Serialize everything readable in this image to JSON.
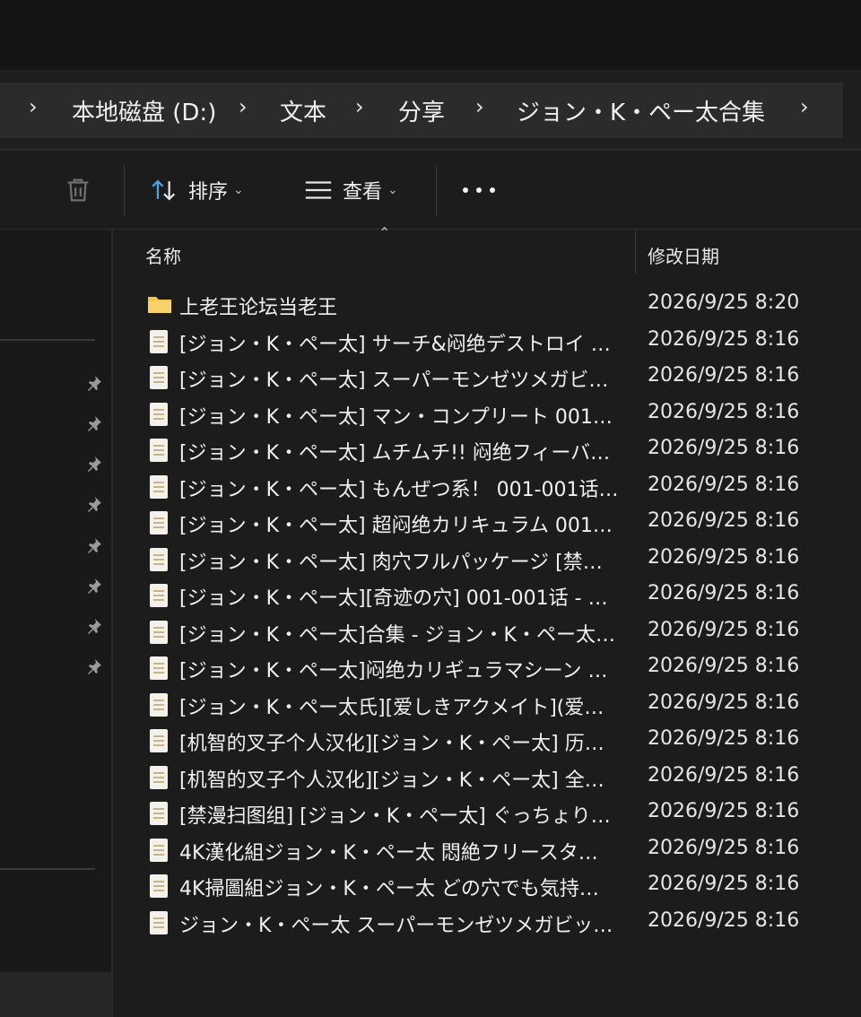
{
  "breadcrumb": {
    "items": [
      "本地磁盘 (D:)",
      "文本",
      "分享",
      "ジョン・K・ペー太合集"
    ]
  },
  "toolbar": {
    "sort_label": "排序",
    "view_label": "查看",
    "delete_icon": "trash-icon",
    "more_icon": "more-icon"
  },
  "columns": {
    "name": "名称",
    "date": "修改日期"
  },
  "files": [
    {
      "name": "上老王论坛当老王",
      "date": "2026/9/25 8:20",
      "type": "folder"
    },
    {
      "name": "[ジョン・K・ペー太] サーチ&闷绝デストロイ …",
      "date": "2026/9/25 8:16",
      "type": "file"
    },
    {
      "name": "[ジョン・K・ペー太] スーパーモンゼツメガビ…",
      "date": "2026/9/25 8:16",
      "type": "file"
    },
    {
      "name": "[ジョン・K・ペー太] マン・コンプリート 001…",
      "date": "2026/9/25 8:16",
      "type": "file"
    },
    {
      "name": "[ジョン・K・ペー太] ムチムチ!! 闷绝フィーバ…",
      "date": "2026/9/25 8:16",
      "type": "file"
    },
    {
      "name": "[ジョン・K・ペー太] もんぜつ系！ 001-001话…",
      "date": "2026/9/25 8:16",
      "type": "file"
    },
    {
      "name": "[ジョン・K・ペー太] 超闷绝カリキュラム 001…",
      "date": "2026/9/25 8:16",
      "type": "file"
    },
    {
      "name": "[ジョン・K・ペー太] 肉穴フルパッケージ [禁…",
      "date": "2026/9/25 8:16",
      "type": "file"
    },
    {
      "name": "[ジョン・K・ペー太][奇迹の穴] 001-001话 - …",
      "date": "2026/9/25 8:16",
      "type": "file"
    },
    {
      "name": "[ジョン・K・ペー太]合集 - ジョン・K・ペー太…",
      "date": "2026/9/25 8:16",
      "type": "file"
    },
    {
      "name": "[ジョン・K・ペー太]闷绝カリギュラマシーン …",
      "date": "2026/9/25 8:16",
      "type": "file"
    },
    {
      "name": "[ジョン・K・ペー太氏][爱しきアクメイト](爱…",
      "date": "2026/9/25 8:16",
      "type": "file"
    },
    {
      "name": "[机智的叉子个人汉化][ジョン・K・ペー太] 历…",
      "date": "2026/9/25 8:16",
      "type": "file"
    },
    {
      "name": "[机智的叉子个人汉化][ジョン・K・ペー太] 全…",
      "date": "2026/9/25 8:16",
      "type": "file"
    },
    {
      "name": "[禁漫扫图组] [ジョン・K・ペー太] ぐっちょり…",
      "date": "2026/9/25 8:16",
      "type": "file"
    },
    {
      "name": "4K漢化組ジョン・K・ペー太 悶絶フリースタ…",
      "date": "2026/9/25 8:16",
      "type": "file"
    },
    {
      "name": "4K掃圖組ジョン・K・ペー太 どの穴でも気持…",
      "date": "2026/9/25 8:16",
      "type": "file"
    },
    {
      "name": "ジョン・K・ペー太 スーパーモンゼツメガビッ…",
      "date": "2026/9/25 8:16",
      "type": "file"
    }
  ],
  "colors": {
    "background": "#1c1c1c",
    "folder": "#f5c84c",
    "accent": "#4ea3e8"
  }
}
